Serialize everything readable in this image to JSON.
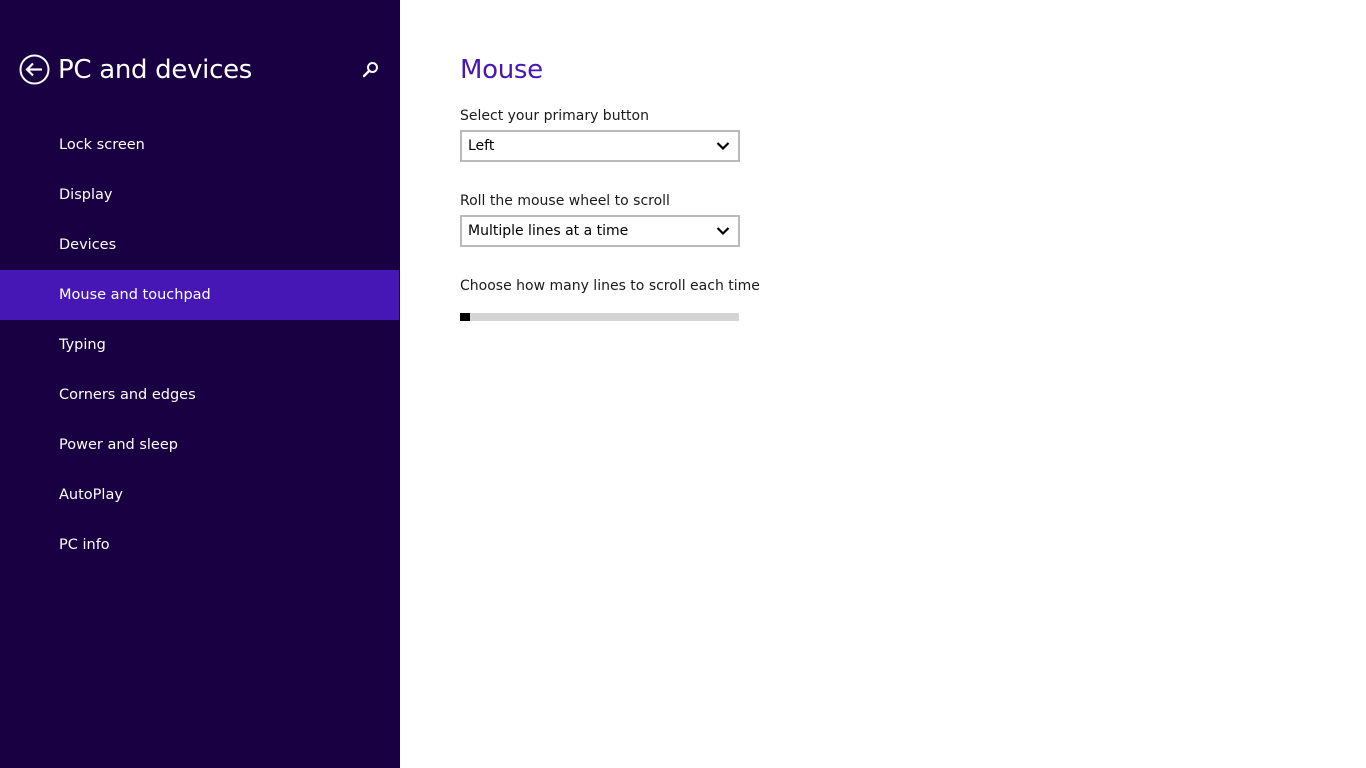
{
  "sidebar": {
    "title": "PC and devices",
    "back_icon": "back-arrow-circle-icon",
    "search_icon": "search-icon",
    "items": [
      {
        "label": "Lock screen",
        "active": false
      },
      {
        "label": "Display",
        "active": false
      },
      {
        "label": "Devices",
        "active": false
      },
      {
        "label": "Mouse and touchpad",
        "active": true
      },
      {
        "label": "Typing",
        "active": false
      },
      {
        "label": "Corners and edges",
        "active": false
      },
      {
        "label": "Power and sleep",
        "active": false
      },
      {
        "label": "AutoPlay",
        "active": false
      },
      {
        "label": "PC info",
        "active": false
      }
    ]
  },
  "main": {
    "title": "Mouse",
    "primary_button": {
      "label": "Select your primary button",
      "value": "Left"
    },
    "wheel_scroll": {
      "label": "Roll the mouse wheel to scroll",
      "value": "Multiple lines at a time"
    },
    "lines_to_scroll": {
      "label": "Choose how many lines to scroll each time",
      "fraction": 0.0
    }
  },
  "colors": {
    "sidebar_bg": "#180042",
    "accent": "#4617b4",
    "selected_item_bg": "#4617b4"
  }
}
